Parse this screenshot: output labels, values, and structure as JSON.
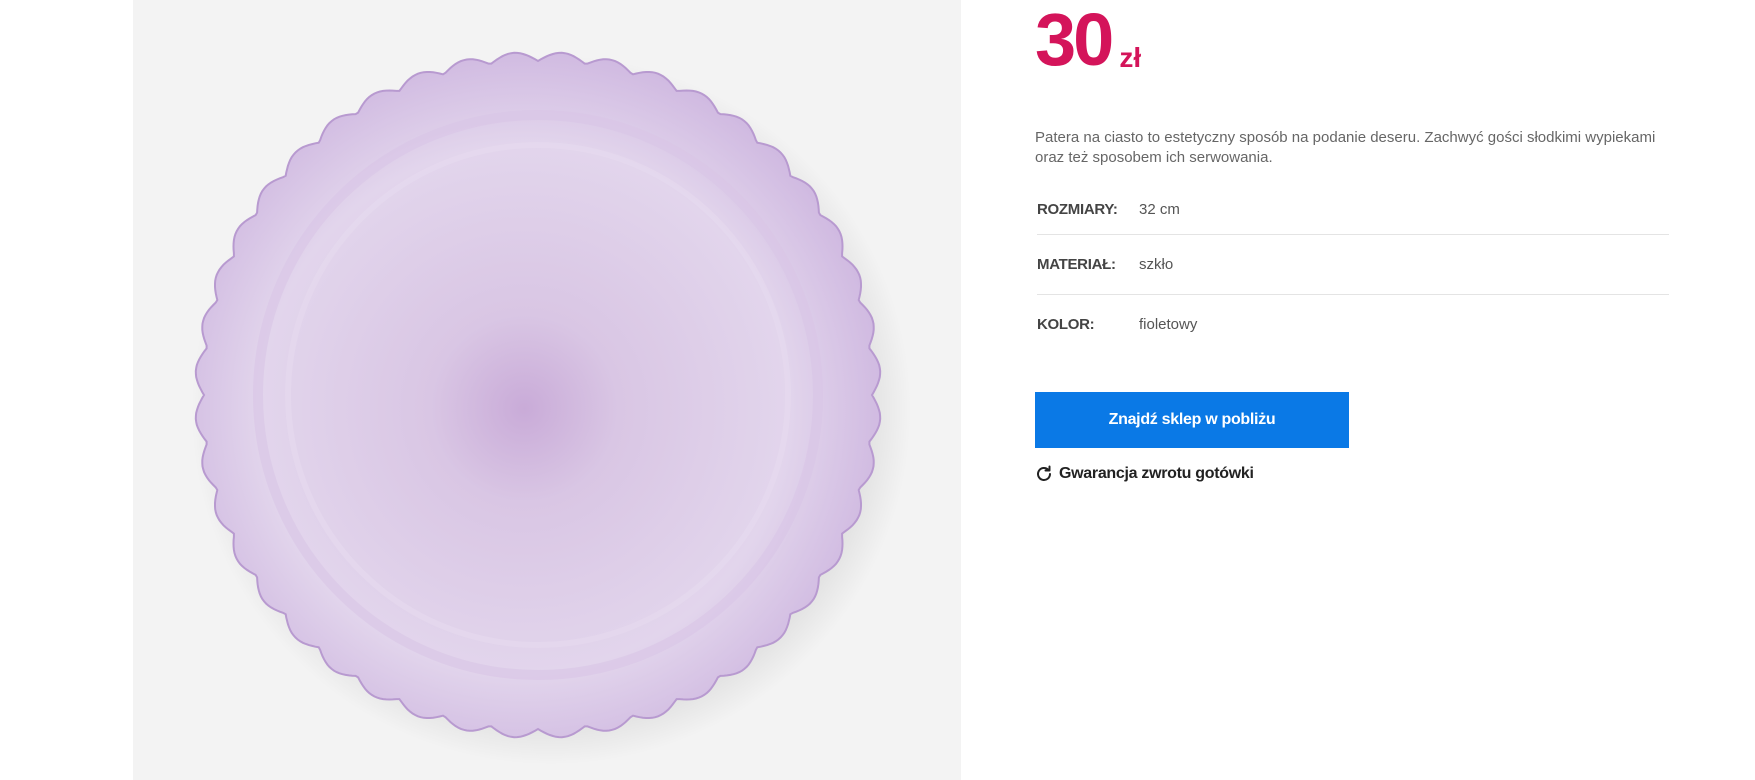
{
  "product": {
    "image_name": "fioletowa-patera-na-ciasto",
    "price": {
      "amount": "30",
      "currency": "zł",
      "color": "#d4145a"
    },
    "description": "Patera na ciasto to estetyczny sposób na podanie deseru. Zachwyć gości słodkimi wypiekami oraz też sposobem ich serwowania.",
    "specs": [
      {
        "label": "ROZMIARY:",
        "value": "32 cm"
      },
      {
        "label": "MATERIAŁ:",
        "value": "szkło"
      },
      {
        "label": "KOLOR:",
        "value": "fioletowy"
      }
    ],
    "store_button": {
      "label": "Znajdź sklep w pobliżu",
      "color": "#0a79e6"
    },
    "guarantee": {
      "icon": "refresh-icon",
      "label": "Gwarancja zwrotu gotówki"
    }
  }
}
